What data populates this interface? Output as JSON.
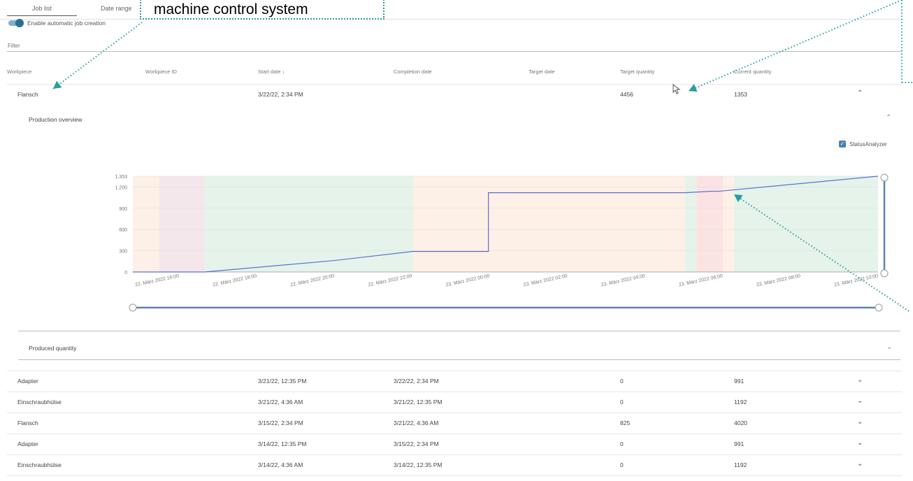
{
  "tabs": [
    {
      "label": "Job list"
    },
    {
      "label": "Date range"
    }
  ],
  "callout_text": "machine control system",
  "toggle_label": "Enable automatic job creation",
  "filter_label": "Filter",
  "columns": [
    "Workpiece",
    "Workpiece ID",
    "Start date ↓",
    "Completion date",
    "Target date",
    "Target quantity",
    "Current quantity"
  ],
  "expanded_row": {
    "workpiece": "Flansch",
    "start": "3/22/22, 2:34 PM",
    "target_qty": "4456",
    "current_qty": "1353"
  },
  "production_overview": "Production overview",
  "status_analyzer": "StatusAnalyzer",
  "produced_quantity": "Produced quantity",
  "rows": [
    {
      "workpiece": "Adapter",
      "start": "3/21/22, 12:35 PM",
      "completion": "3/22/22, 2:34 PM",
      "target_qty": "0",
      "current_qty": "991"
    },
    {
      "workpiece": "Einschraubhülse",
      "start": "3/21/22, 4:36 AM",
      "completion": "3/21/22, 12:35 PM",
      "target_qty": "0",
      "current_qty": "1192"
    },
    {
      "workpiece": "Flansch",
      "start": "3/15/22, 2:34 PM",
      "completion": "3/21/22, 4:36 AM",
      "target_qty": "825",
      "current_qty": "4020"
    },
    {
      "workpiece": "Adapter",
      "start": "3/14/22, 12:35 PM",
      "completion": "3/15/22, 2:34 PM",
      "target_qty": "0",
      "current_qty": "991"
    },
    {
      "workpiece": "Einschraubhülse",
      "start": "3/14/22, 4:36 AM",
      "completion": "3/14/22, 12:35 PM",
      "target_qty": "0",
      "current_qty": "1192"
    }
  ],
  "colors": {
    "accent": "#2b6f94",
    "line": "#5b6fd0",
    "callout": "#2a9d9d",
    "green_bg": "#e6f3ea",
    "orange_bg": "#fdf0e6",
    "red_bg": "#fbe3e3"
  },
  "chart_data": {
    "type": "line",
    "y_ticks": [
      "0",
      "300",
      "600",
      "900",
      "1.200",
      "1.353"
    ],
    "y_tick_values": [
      0,
      300,
      600,
      900,
      1200,
      1353
    ],
    "x_ticks": [
      "22. März 2022 16:00",
      "22. März 2022 18:00",
      "22. März 2022 20:00",
      "22. März 2022 22:00",
      "23. März 2022 00:00",
      "23. März 2022 02:00",
      "23. März 2022 04:00",
      "23. März 2022 06:00",
      "23. März 2022 08:00",
      "23. März 2022 10:00"
    ],
    "ylim": [
      0,
      1353
    ],
    "x_hours": [
      14.6,
      16.5,
      19.9,
      22.0,
      23.3,
      0.0,
      5.2,
      5.9,
      6.1,
      10.3
    ],
    "x_day": [
      22,
      22,
      22,
      22,
      22,
      23,
      23,
      23,
      23,
      23
    ],
    "values": [
      0,
      0,
      160,
      290,
      290,
      1120,
      1120,
      1140,
      1140,
      1353
    ],
    "status_bands": [
      {
        "day": 22,
        "start": 14.6,
        "end": 15.3,
        "status": "orange"
      },
      {
        "day": 22,
        "start": 15.3,
        "end": 16.5,
        "status": "mixed"
      },
      {
        "day": 22,
        "start": 16.5,
        "end": 22.0,
        "status": "green"
      },
      {
        "day": 22,
        "start": 22.0,
        "end": 29.2,
        "status": "orange"
      },
      {
        "day": 23,
        "start": 5.2,
        "end": 5.5,
        "status": "green"
      },
      {
        "day": 23,
        "start": 5.5,
        "end": 6.2,
        "status": "red"
      },
      {
        "day": 23,
        "start": 6.2,
        "end": 6.5,
        "status": "orange"
      },
      {
        "day": 23,
        "start": 6.5,
        "end": 10.3,
        "status": "green"
      }
    ],
    "grid": true,
    "legend": "top-right"
  }
}
